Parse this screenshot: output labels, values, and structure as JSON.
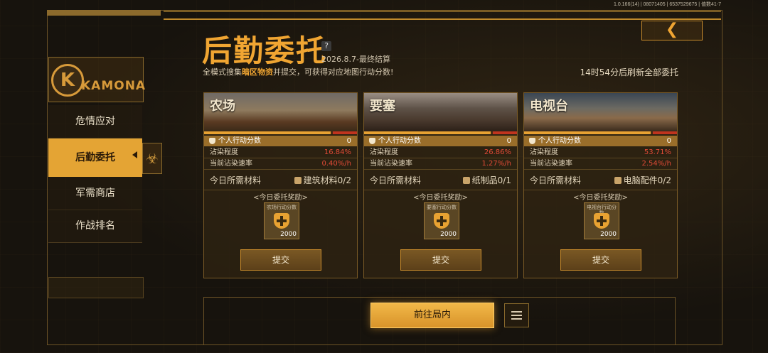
{
  "version": "1.0.166(14) | 08071405 | 6537529675 | 值数41-7",
  "header": {
    "title": "后勤委托",
    "help": "?",
    "deadline": "2026.8.7-最终结算",
    "subtitle_prefix": "全模式搜集",
    "subtitle_highlight": "暗区物资",
    "subtitle_suffix": "并提交，可获得对应地图行动分数!",
    "refresh_text": "14时54分后刷新全部委托",
    "back_icon": "chevron-left-icon"
  },
  "sidebar": {
    "logo_text": "KAMONA",
    "items": [
      {
        "label": "危情应对"
      },
      {
        "label": "后勤委托"
      },
      {
        "label": "军需商店"
      },
      {
        "label": "作战排名"
      }
    ],
    "active_index": 1
  },
  "labels": {
    "score": "个人行动分数",
    "pollution": "沾染程度",
    "rate": "当前沾染速率",
    "materials": "今日所需材料",
    "reward_title": "<今日委托奖励>",
    "submit": "提交"
  },
  "cards": [
    {
      "name": "农场",
      "score": "0",
      "pollution": "16.84%",
      "rate": "0.40%/h",
      "progress": 0.83,
      "material": "建筑材料0/2",
      "reward_name": "农场行动分数",
      "reward_amount": "2000"
    },
    {
      "name": "要塞",
      "score": "0",
      "pollution": "26.86%",
      "rate": "1.27%/h",
      "progress": 0.83,
      "material": "纸制品0/1",
      "reward_name": "要塞行动分数",
      "reward_amount": "2000"
    },
    {
      "name": "电视台",
      "score": "0",
      "pollution": "53.71%",
      "rate": "2.54%/h",
      "progress": 0.83,
      "material": "电脑配件0/2",
      "reward_name": "电视台行动分数",
      "reward_amount": "2000"
    }
  ],
  "bottom": {
    "go_label": "前往局内",
    "menu_icon": "list-menu-icon"
  },
  "colors": {
    "accent": "#f0a532",
    "danger": "#e04a36",
    "panel": "#2d2212"
  }
}
